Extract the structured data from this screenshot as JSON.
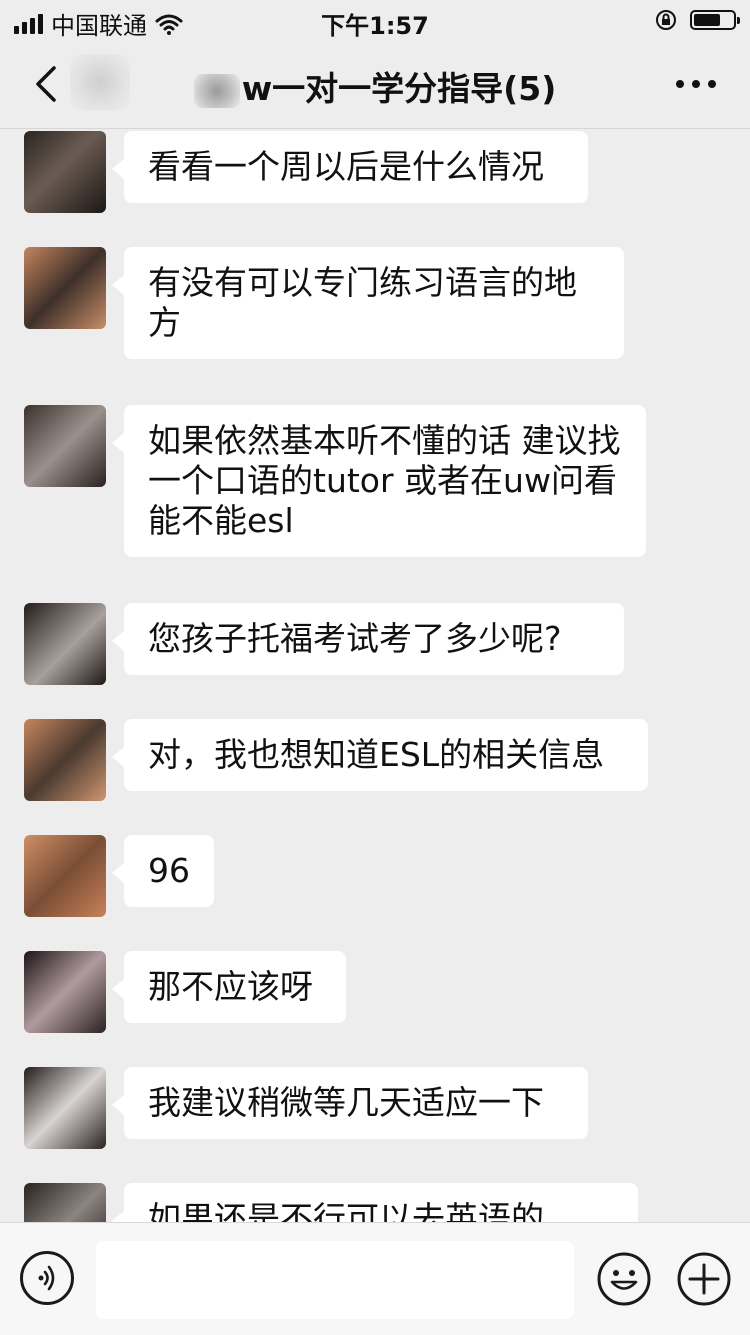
{
  "status": {
    "carrier": "中国联通",
    "time": "下午1:57"
  },
  "header": {
    "title": "w一对一学分指导(5)"
  },
  "messages": [
    {
      "text": "看看一个周以后是什么情况"
    },
    {
      "text": "有没有可以专门练习语言的地方"
    },
    {
      "text": "如果依然基本听不懂的话 建议找一个口语的tutor 或者在uw问看能不能esl"
    },
    {
      "text": "您孩子托福考试考了多少呢?"
    },
    {
      "text": "对，我也想知道ESL的相关信息"
    },
    {
      "text": "96"
    },
    {
      "text": "那不应该呀"
    },
    {
      "text": "我建议稍微等几天适应一下"
    },
    {
      "text": "如果还是不行可以去英语的"
    }
  ],
  "icons": {
    "back": "chevron-left-icon",
    "more": "more-dots-icon",
    "voice": "voice-icon",
    "emoji": "emoji-icon",
    "plus": "plus-icon"
  },
  "colors": {
    "background": "#ededed",
    "bubble": "#ffffff",
    "text": "#111111"
  }
}
